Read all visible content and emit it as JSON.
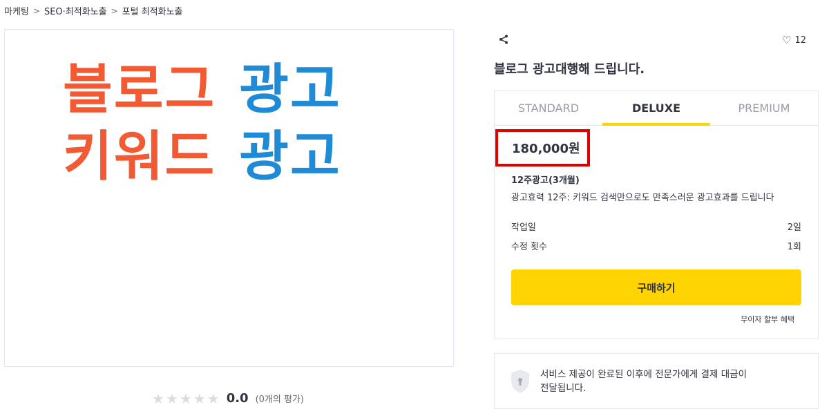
{
  "breadcrumb": {
    "items": [
      "마케팅",
      "SEO·최적화노출",
      "포털 최적화노출"
    ],
    "separator": ">"
  },
  "hero": {
    "line1_left": "블로그",
    "line1_right": "광고",
    "line2_left": "키워드",
    "line2_right": "광고",
    "colors": {
      "orange": "#f25a33",
      "blue": "#1f8ad6"
    }
  },
  "rating": {
    "stars": 5,
    "filled_stars": 0,
    "score": "0.0",
    "count_text": "(0개의 평가)"
  },
  "product": {
    "share_icon": "share-icon",
    "like_icon": "heart-icon",
    "like_count": "12",
    "title": "블로그 광고대행해 드립니다."
  },
  "package": {
    "tabs": [
      {
        "label": "STANDARD",
        "active": false
      },
      {
        "label": "DELUXE",
        "active": true
      },
      {
        "label": "PREMIUM",
        "active": false
      }
    ],
    "price": "180,000원",
    "name": "12주광고(3개월)",
    "description": "광고효력 12주: 키워드 검색만으로도 만족스러운 광고효과를 드립니다",
    "specs": [
      {
        "label": "작업일",
        "value": "2일"
      },
      {
        "label": "수정 횟수",
        "value": "1회"
      }
    ],
    "buy_button": "구매하기",
    "installment": "무이자 할부 혜택"
  },
  "safety": {
    "line1": "서비스 제공이 완료된 이후에 전문가에게 결제 대금이",
    "line2": "전달됩니다."
  },
  "colors": {
    "accent_yellow": "#ffd400",
    "highlight_red": "#e00000",
    "border": "#e4e5ed",
    "text": "#303441"
  }
}
